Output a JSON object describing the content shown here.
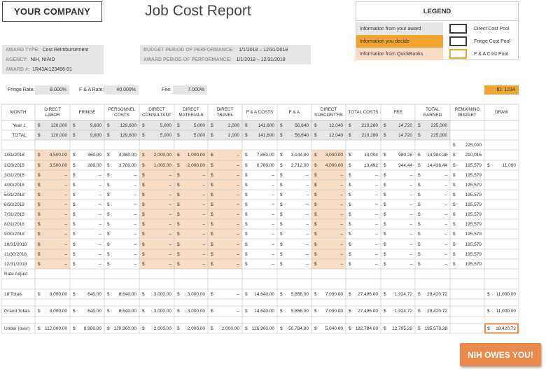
{
  "company": "YOUR COMPANY",
  "title": "Job Cost Report",
  "legend": {
    "title": "LEGEND",
    "rows": [
      {
        "info": "Information from your award",
        "info_color": "#e6e6e6",
        "box_color": "#3d3d3d",
        "label": "Direct Cost Pool"
      },
      {
        "info": "Information you decide",
        "info_color": "#f0a432",
        "box_color": "#3d3d3d",
        "label": "Fringe Cost Pool"
      },
      {
        "info": "Information from QuickBooks",
        "info_color": "#f8dcc4",
        "box_color": "#f0a432",
        "label": "F & A Cost Pool"
      }
    ]
  },
  "award": [
    {
      "k": "AWARD TYPE:",
      "v": "Cost Reimbursement"
    },
    {
      "k": "AGENCY:",
      "v": "NIH, NIAID"
    },
    {
      "k": "AWARD #:",
      "v": "1R43AI123456-01"
    }
  ],
  "periods": [
    {
      "k": "BUDGET PERIOD OF PERFORMANCE:",
      "v": "1/1/2018 – 12/31/2018"
    },
    {
      "k": "AWARD PERIOD OF PERFORMANCE:",
      "v": "1/1/2018 – 12/31/2018"
    }
  ],
  "rates": {
    "fringe_label": "Fringe Rate:",
    "fringe": "8.000%",
    "fa_label": "F & A Rate:",
    "fa": "40.000%",
    "fee_label": "Fee:",
    "fee": "7.000%",
    "id": "ID: 1234"
  },
  "headers": [
    "MONTH",
    "DIRECT\nLABOR",
    "FRINGE",
    "PERSONNEL\nCOSTS",
    "DIRECT\nCONSULTANT",
    "DIRECT\nMATERIALS",
    "DIRECT\nTRAVEL",
    "F & A COSTS",
    "F & A",
    "DIRECT\nSUBCONT'RS",
    "TOTAL COSTS",
    "FEE",
    "TOTAL\nEARNED",
    "REMAINING\nBUDGET",
    "DRAW"
  ],
  "rows": [
    [
      "Year 1",
      "120,000",
      "9,600",
      "129,600",
      "5,000",
      "5,000",
      "2,000",
      "141,600",
      "56,640",
      "12,040",
      "210,280",
      "14,720",
      "225,000",
      "",
      ""
    ],
    [
      "TOTAL",
      "120,000",
      "9,600",
      "129,600",
      "5,000",
      "5,000",
      "2,000",
      "141,600",
      "56,640",
      "12,040",
      "210,280",
      "14,720",
      "225,000",
      "",
      ""
    ],
    [
      "",
      "",
      "",
      "",
      "",
      "",
      "",
      "",
      "",
      "",
      "",
      "",
      "",
      "225,000",
      ""
    ],
    [
      "1/31/2018",
      "4,500.00",
      "360.00",
      "4,860.00",
      "2,000.00",
      "1,000.00",
      "–",
      "7,860.00",
      "3,144.00",
      "3,000.00",
      "14,004",
      "980.28",
      "14,984.28",
      "210,016",
      ""
    ],
    [
      "2/28/2018",
      "3,500.00",
      "280.00",
      "3,780.00",
      "1,000.00",
      "2,000.00",
      "–",
      "6,780.00",
      "2,712.00",
      "4,000.00",
      "13,492",
      "944.44",
      "14,436.44",
      "195,579",
      "11,000"
    ],
    [
      "3/31/2018",
      "–",
      "–",
      "–",
      "–",
      "–",
      "–",
      "–",
      "–",
      "–",
      "–",
      "–",
      "–",
      "195,579",
      ""
    ],
    [
      "4/30/2018",
      "–",
      "–",
      "–",
      "–",
      "–",
      "–",
      "–",
      "–",
      "–",
      "–",
      "–",
      "–",
      "195,579",
      ""
    ],
    [
      "5/31/2018",
      "–",
      "–",
      "–",
      "–",
      "–",
      "–",
      "–",
      "–",
      "–",
      "–",
      "–",
      "–",
      "195,579",
      ""
    ],
    [
      "6/30/2018",
      "–",
      "–",
      "–",
      "–",
      "–",
      "–",
      "–",
      "–",
      "–",
      "–",
      "–",
      "–",
      "195,579",
      ""
    ],
    [
      "7/31/2018",
      "–",
      "–",
      "–",
      "–",
      "–",
      "–",
      "–",
      "–",
      "–",
      "–",
      "–",
      "–",
      "195,579",
      ""
    ],
    [
      "8/31/2018",
      "–",
      "–",
      "–",
      "–",
      "–",
      "–",
      "–",
      "–",
      "–",
      "–",
      "–",
      "–",
      "195,579",
      ""
    ],
    [
      "9/30/2018",
      "–",
      "–",
      "–",
      "–",
      "–",
      "–",
      "–",
      "–",
      "–",
      "–",
      "–",
      "–",
      "195,579",
      ""
    ],
    [
      "10/31/2018",
      "–",
      "–",
      "–",
      "–",
      "–",
      "–",
      "–",
      "–",
      "–",
      "–",
      "–",
      "–",
      "195,579",
      ""
    ],
    [
      "11/30/2018",
      "–",
      "–",
      "–",
      "–",
      "–",
      "–",
      "–",
      "–",
      "–",
      "–",
      "–",
      "–",
      "195,579",
      ""
    ],
    [
      "12/31/2018",
      "–",
      "–",
      "–",
      "–",
      "–",
      "–",
      "–",
      "–",
      "–",
      "–",
      "–",
      "–",
      "195,579",
      ""
    ],
    [
      "Rate Adjust",
      "",
      "",
      "",
      "",
      "",
      "",
      "",
      "",
      "",
      "",
      "",
      "",
      "",
      ""
    ],
    [
      "",
      "",
      "",
      "",
      "",
      "",
      "",
      "",
      "",
      "",
      "",
      "",
      "",
      "",
      ""
    ],
    [
      "18 Totals",
      "8,000.00",
      "640.00",
      "8,640.00",
      "3,000.00",
      "3,000.00",
      "–",
      "14,640.00",
      "5,856.00",
      "7,000.00",
      "27,496.00",
      "1,924.72",
      "29,420.72",
      "",
      "11,000.00"
    ],
    [
      "",
      "",
      "",
      "",
      "",
      "",
      "",
      "",
      "",
      "",
      "",
      "",
      "",
      "",
      ""
    ],
    [
      "Grand Totals",
      "8,000.00",
      "640.00",
      "8,640.00",
      "3,000.00",
      "3,000.00",
      "–",
      "14,640.00",
      "5,856.00",
      "7,000.00",
      "27,496.00",
      "1,924.72",
      "29,420.72",
      "",
      "11,000.00"
    ],
    [
      "",
      "",
      "",
      "",
      "",
      "",
      "",
      "",
      "",
      "",
      "",
      "",
      "",
      "",
      ""
    ],
    [
      "Under (over)",
      "112,000.00",
      "8,960.00",
      "120,960.00",
      "2,000.00",
      "2,000.00",
      "2,000.00",
      "126,960.00",
      "50,784.00",
      "5,040.00",
      "182,784.00",
      "12,795.28",
      "195,579.28",
      "",
      "18,420.72"
    ]
  ],
  "owes": "NIH OWES YOU!"
}
